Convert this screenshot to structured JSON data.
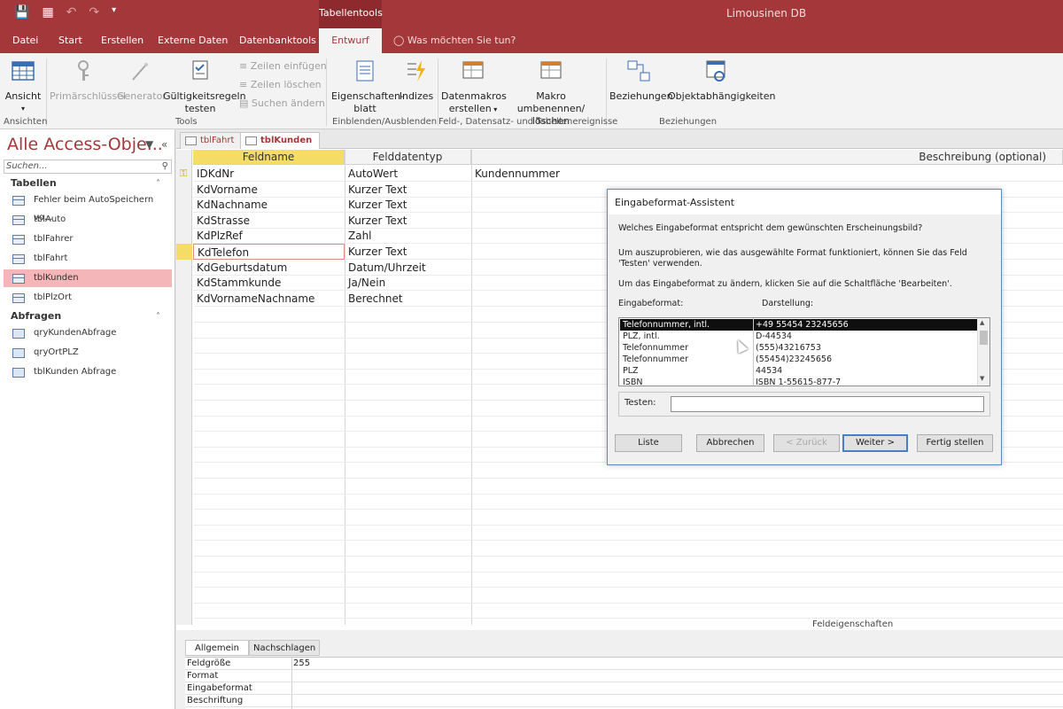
{
  "titlebar": {
    "contextual_tab": "Tabellentools",
    "document_title": "Limousinen DB"
  },
  "tabs": [
    "Datei",
    "Start",
    "Erstellen",
    "Externe Daten",
    "Datenbanktools",
    "Entwurf"
  ],
  "active_tab": "Entwurf",
  "tell_me": "Was möchten Sie tun?",
  "ribbon": {
    "ansicht": "Ansicht",
    "primaerschluessel": "Primärschlüssel",
    "generator": "Generator",
    "gueltigkeit_1": "Gültigkeitsregeln",
    "gueltigkeit_2": "testen",
    "zeilen_einfuegen": "Zeilen einfügen",
    "zeilen_loeschen": "Zeilen löschen",
    "suchen_aendern": "Suchen ändern",
    "eigenschaften_1": "Eigenschaften-",
    "eigenschaften_2": "blatt",
    "indizes": "Indizes",
    "datenmakros_1": "Datenmakros",
    "datenmakros_2": "erstellen",
    "makro_1": "Makro umbenennen/",
    "makro_2": "löschen",
    "beziehungen": "Beziehungen",
    "objektabh": "Objektabhängigkeiten",
    "groups": {
      "ansichten": "Ansichten",
      "tools": "Tools",
      "einblenden": "Einblenden/Ausblenden",
      "ereignisse": "Feld-, Datensatz- und Tabellenereignisse",
      "beziehungen": "Beziehungen"
    }
  },
  "nav": {
    "title": "Alle Access-Obje...",
    "search_placeholder": "Suchen...",
    "group_tables": "Tabellen",
    "tables": [
      "Fehler beim AutoSpeichern vo...",
      "tblAuto",
      "tblFahrer",
      "tblFahrt",
      "tblKunden",
      "tblPlzOrt"
    ],
    "selected_table": "tblKunden",
    "group_queries": "Abfragen",
    "queries": [
      "qryKundenAbfrage",
      "qryOrtPLZ",
      "tblKunden Abfrage"
    ]
  },
  "doc_tabs": [
    "tblFahrt",
    "tblKunden"
  ],
  "grid": {
    "headers": [
      "Feldname",
      "Felddatentyp",
      "Beschreibung (optional)"
    ],
    "rows": [
      {
        "name": "IDKdNr",
        "type": "AutoWert",
        "desc": "Kundennummer"
      },
      {
        "name": "KdVorname",
        "type": "Kurzer Text",
        "desc": ""
      },
      {
        "name": "KdNachname",
        "type": "Kurzer Text",
        "desc": ""
      },
      {
        "name": "KdStrasse",
        "type": "Kurzer Text",
        "desc": ""
      },
      {
        "name": "KdPlzRef",
        "type": "Zahl",
        "desc": ""
      },
      {
        "name": "KdTelefon",
        "type": "Kurzer Text",
        "desc": ""
      },
      {
        "name": "KdGeburtsdatum",
        "type": "Datum/Uhrzeit",
        "desc": ""
      },
      {
        "name": "KdStammkunde",
        "type": "Ja/Nein",
        "desc": ""
      },
      {
        "name": "KdVornameNachname",
        "type": "Berechnet",
        "desc": ""
      }
    ],
    "current_row": 5
  },
  "field_props": {
    "label": "Feldeigenschaften",
    "tab_general": "Allgemein",
    "tab_lookup": "Nachschlagen",
    "rows": [
      {
        "k": "Feldgröße",
        "v": "255"
      },
      {
        "k": "Format",
        "v": ""
      },
      {
        "k": "Eingabeformat",
        "v": ""
      },
      {
        "k": "Beschriftung",
        "v": ""
      }
    ]
  },
  "dialog": {
    "title": "Eingabeformat-Assistent",
    "question": "Welches Eingabeformat entspricht dem gewünschten Erscheinungsbild?",
    "info1": "Um auszuprobieren, wie das ausgewählte Format funktioniert, können Sie das Feld 'Testen' verwenden.",
    "info2": "Um das Eingabeformat zu ändern, klicken Sie auf die Schaltfläche 'Bearbeiten'.",
    "col_format": "Eingabeformat:",
    "col_display": "Darstellung:",
    "list": [
      {
        "format": "Telefonnummer, intl.",
        "display": "+49 55454 23245656"
      },
      {
        "format": "PLZ, intl.",
        "display": "D-44534"
      },
      {
        "format": "Telefonnummer",
        "display": "(555)43216753"
      },
      {
        "format": "Telefonnummer",
        "display": "(55454)23245656"
      },
      {
        "format": "PLZ",
        "display": "44534"
      },
      {
        "format": "ISBN",
        "display": "ISBN 1-55615-877-7"
      }
    ],
    "selected_index": 0,
    "testen_label": "Testen:",
    "testen_value": "",
    "btn_liste": "Liste",
    "btn_abbrechen": "Abbrechen",
    "btn_zurueck": "< Zurück",
    "btn_weiter": "Weiter >",
    "btn_fertig": "Fertig stellen"
  },
  "colors": {
    "accent": "#a4373a",
    "selected_header": "#f5dc67",
    "nav_selected": "#f4b6b8"
  }
}
